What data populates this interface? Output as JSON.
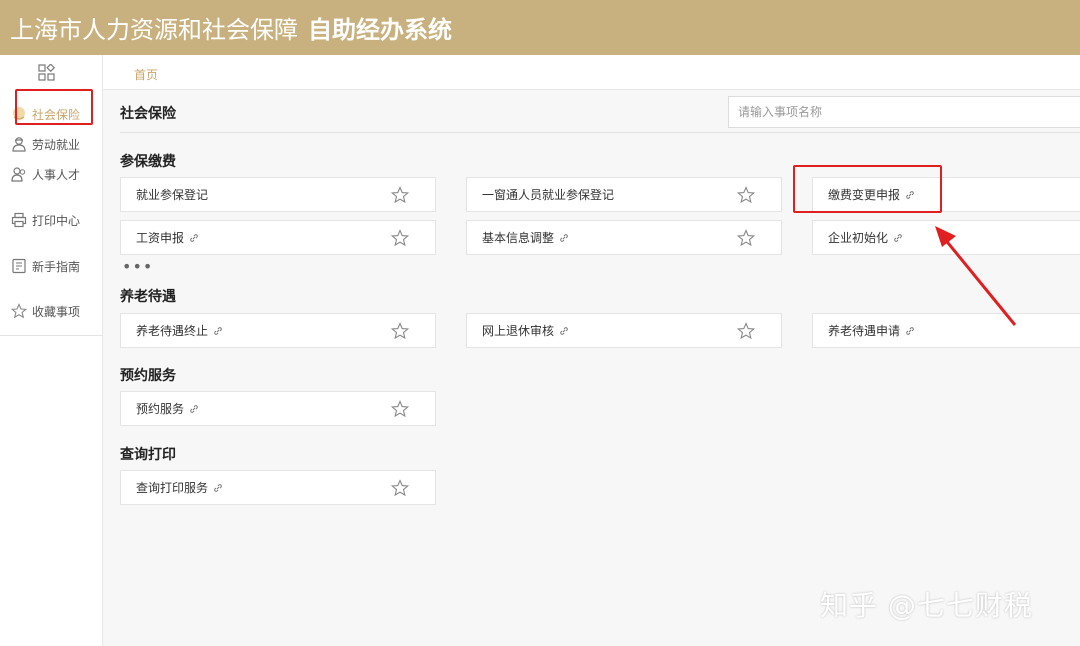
{
  "header": {
    "title_main": "上海市人力资源和社会保障",
    "title_bold": "自助经办系统"
  },
  "sidebar": {
    "items": [
      {
        "label": "社会保险",
        "icon": "hand-heart-icon",
        "active": true
      },
      {
        "label": "劳动就业",
        "icon": "worker-icon"
      },
      {
        "label": "人事人才",
        "icon": "people-icon"
      },
      {
        "label": "打印中心",
        "icon": "printer-icon"
      },
      {
        "label": "新手指南",
        "icon": "guide-icon"
      },
      {
        "label": "收藏事项",
        "icon": "star-icon"
      }
    ]
  },
  "breadcrumb": {
    "home": "首页"
  },
  "main": {
    "title": "社会保险",
    "search_placeholder": "请输入事项名称",
    "sections": [
      {
        "title": "参保缴费",
        "items": [
          "就业参保登记",
          "一窗通人员就业参保登记",
          "缴费变更申报",
          "工资申报",
          "基本信息调整",
          "企业初始化"
        ]
      },
      {
        "title": "养老待遇",
        "items": [
          "养老待遇终止",
          "网上退休审核",
          "养老待遇申请"
        ]
      },
      {
        "title": "预约服务",
        "items": [
          "预约服务"
        ]
      },
      {
        "title": "查询打印",
        "items": [
          "查询打印服务"
        ]
      }
    ],
    "more": "•••"
  },
  "watermark": "知乎 @七七财税",
  "colors": {
    "header": "#c9b17f",
    "accent": "#c9a56a",
    "highlight": "#e02020"
  }
}
